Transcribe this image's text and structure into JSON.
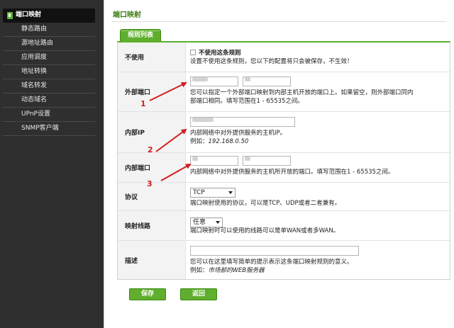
{
  "sidebar": {
    "items": [
      {
        "label": "端口映射",
        "active": true
      },
      {
        "label": "静态路由"
      },
      {
        "label": "源地址路由"
      },
      {
        "label": "应用调度"
      },
      {
        "label": "地址转换"
      },
      {
        "label": "域名转发"
      },
      {
        "label": "动态域名"
      },
      {
        "label": "UPnP设置"
      },
      {
        "label": "SNMP客户端"
      }
    ]
  },
  "page": {
    "title": "端口映射",
    "tab": "规则列表"
  },
  "form": {
    "disable": {
      "label": "不使用",
      "checkbox_label": "不使用这条规则",
      "checked": false,
      "help": "设置不使用这条规则，您以下的配置将只会被保存，不生效！"
    },
    "external_port": {
      "label": "外部端口",
      "help1": "您可以指定一个外部端口映射到内部主机开放的端口上。如果留空，则外部端口同内",
      "help2": "部端口相同。填写范围在1 - 65535之间。"
    },
    "internal_ip": {
      "label": "内部IP",
      "help": "内部网络中对外提供服务的主机IP。",
      "example_prefix": "例如：",
      "example_value": "192.168.0.50"
    },
    "internal_port": {
      "label": "内部端口",
      "help": "内部网络中对外提供服务的主机所开放的端口。填写范围在1 - 65535之间。"
    },
    "protocol": {
      "label": "协议",
      "selected": "TCP",
      "help": "端口映射使用的协议，可以是TCP、UDP或者二者兼有。"
    },
    "line": {
      "label": "映射线路",
      "selected": "任意",
      "help": "端口映射时可以使用的线路可以是单WAN或者多WAN。"
    },
    "description": {
      "label": "描述",
      "value": "",
      "help": "您可以在这里填写简单的提示表示这条端口映射规则的意义。",
      "example_prefix": "例如：",
      "example_value": "市场部的WEB服务器"
    }
  },
  "buttons": {
    "save": "保存",
    "back": "返回"
  },
  "annotations": {
    "one": "1",
    "two": "2",
    "three": "3"
  },
  "colors": {
    "accent_green": "#5fae2d",
    "title_green": "#3c7d14",
    "sidebar_bg": "#2f2f2f",
    "annotation_red": "#d21f1f"
  }
}
